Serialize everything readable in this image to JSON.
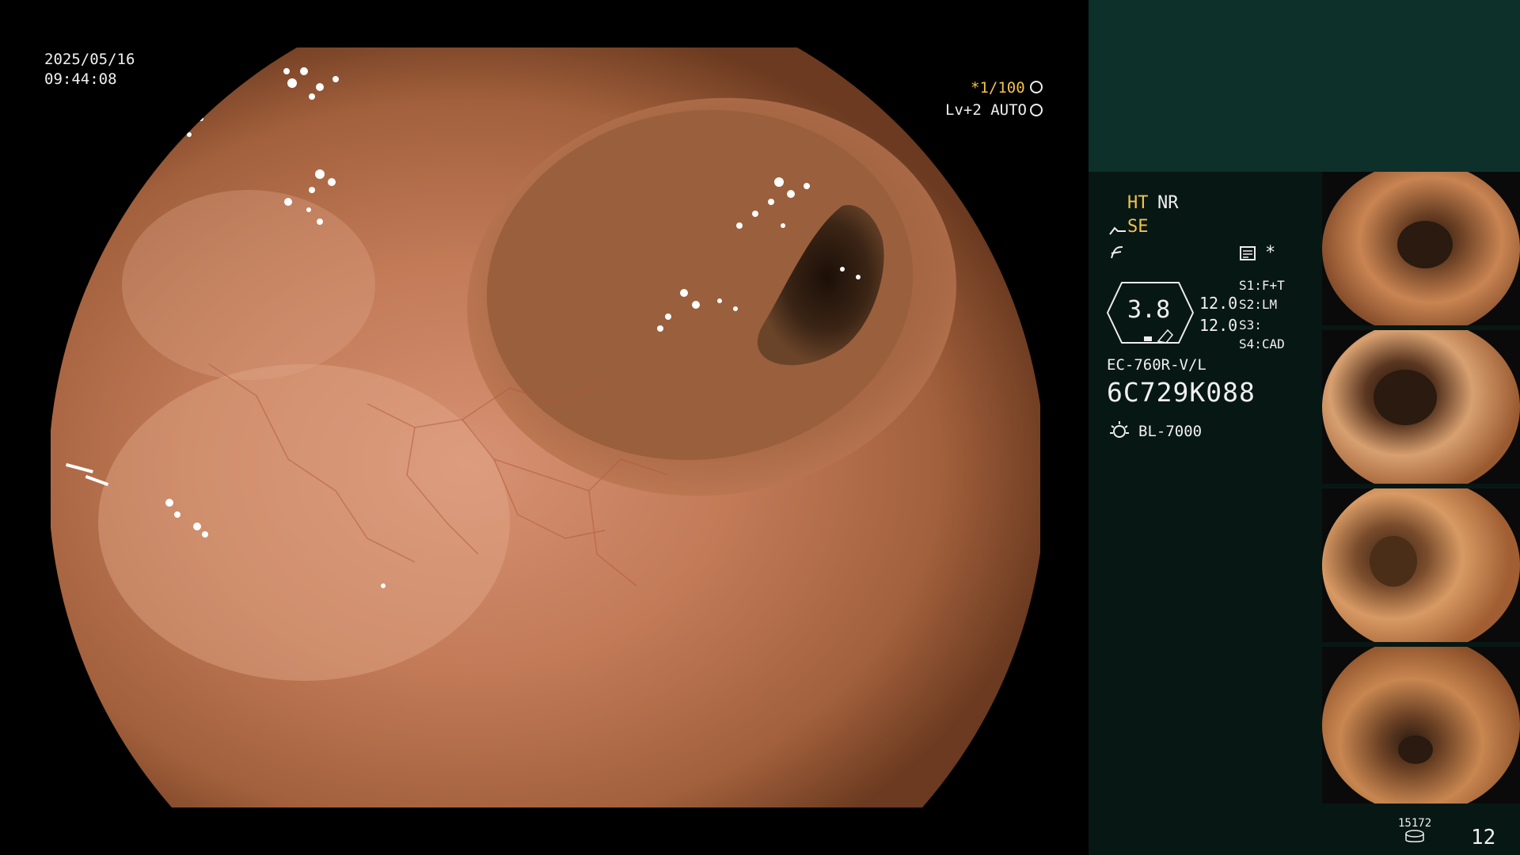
{
  "video": {
    "date": "2025/05/16",
    "time": "09:44:08",
    "shutter": "*1/100",
    "shutter_icon": "aperture-icon",
    "iris": "Lv+2 AUTO",
    "iris_icon": "iris-icon"
  },
  "settings": {
    "ht": "HT",
    "nr": "NR",
    "se": "SE",
    "se_icon": "scope-curve-icon",
    "freeze_icon": "freeze-icon",
    "capture_icon": "capture-icon",
    "star": "*",
    "gauge_value": "3.8",
    "value_1": "12.0",
    "value_2": "12.0",
    "switches": [
      "S1:F+T",
      "S2:LM",
      "S3:",
      "S4:CAD"
    ],
    "model": "EC-760R-V/L",
    "serial": "6C729K088",
    "light_icon": "light-source-icon",
    "light_source": "BL-7000"
  },
  "footer": {
    "counter_top": "15172",
    "counter_icon": "storage-icon",
    "page": "12"
  },
  "thumbnails": [
    "thumbnail-1",
    "thumbnail-2",
    "thumbnail-3",
    "thumbnail-4"
  ],
  "colors": {
    "tissue": "#b36a44",
    "lumen": "#3b2416",
    "sidebar_top": "#0d302a",
    "sidebar": "#071714",
    "accent": "#f4c24a"
  }
}
